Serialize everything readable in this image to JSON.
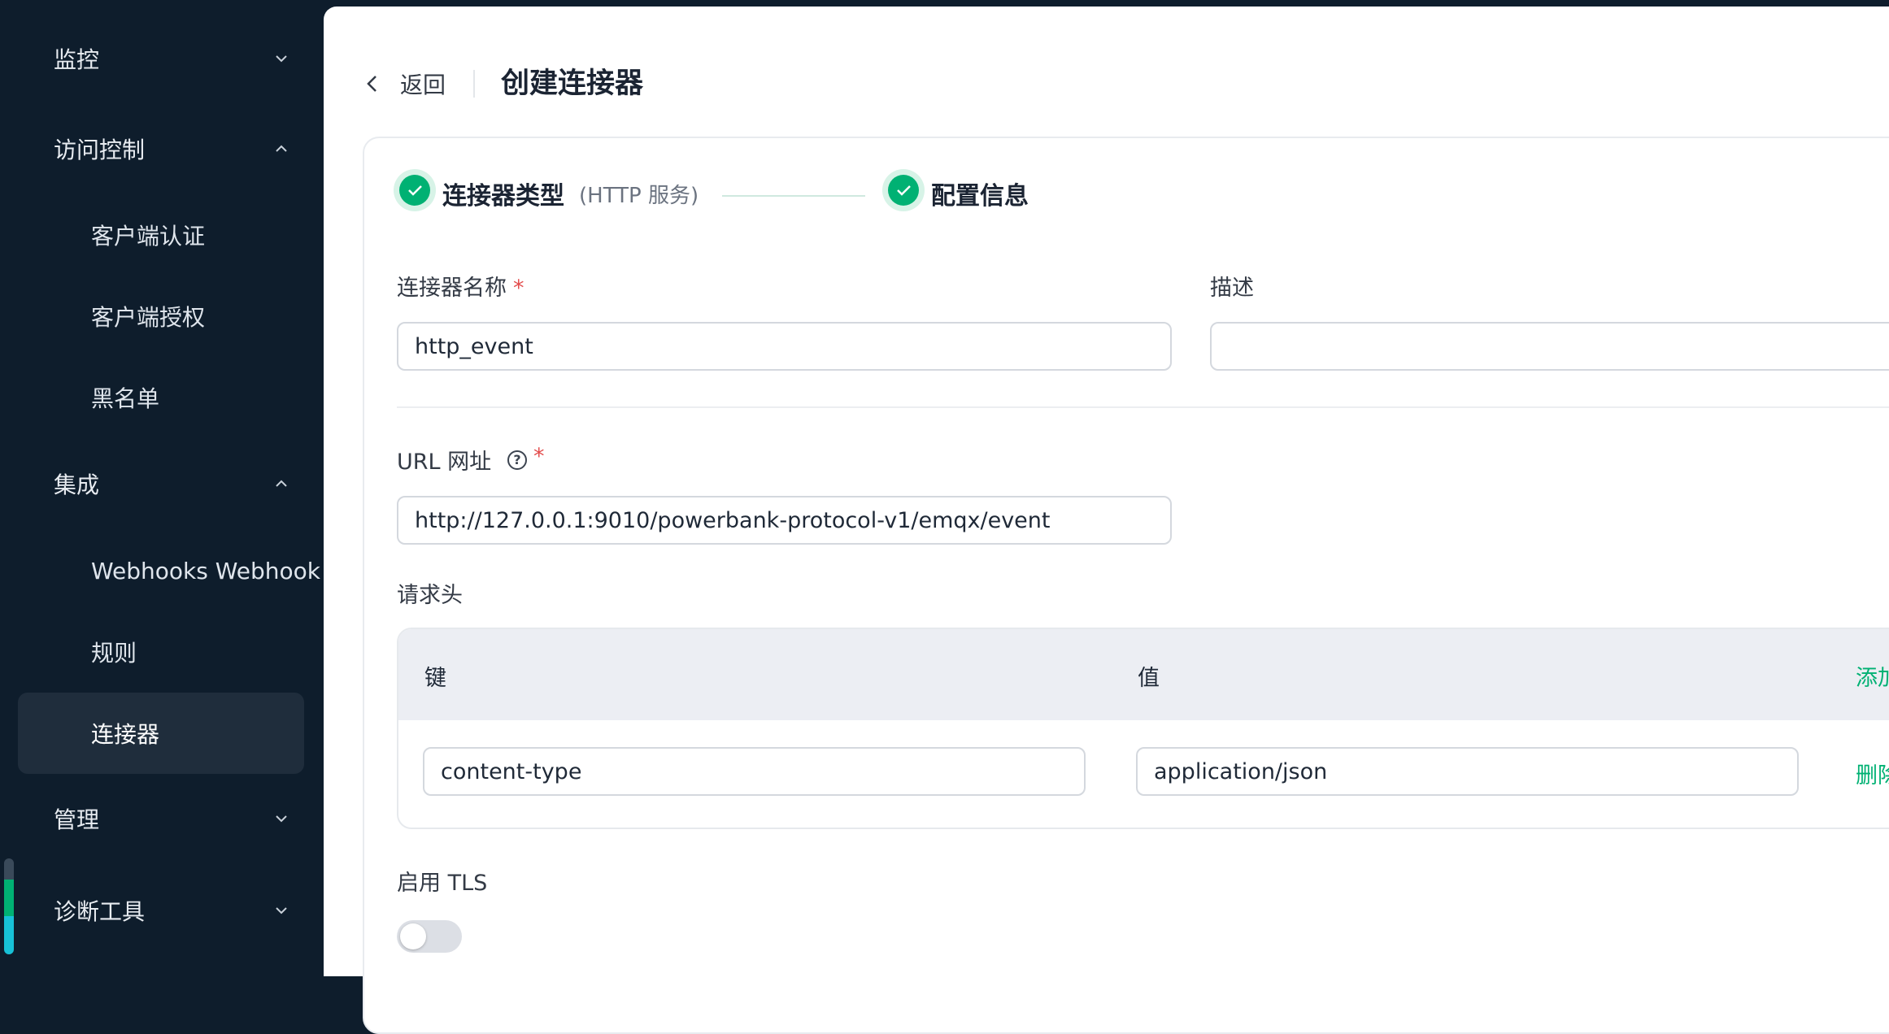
{
  "sidebar": {
    "groups": {
      "monitor": "监控",
      "access": "访问控制",
      "integration": "集成",
      "management": "管理",
      "diagnostics": "诊断工具"
    },
    "items": {
      "client_auth": "客户端认证",
      "client_authz": "客户端授权",
      "blacklist": "黑名单",
      "webhooks": "Webhooks  Webhook",
      "rules": "规则",
      "connectors": "连接器"
    }
  },
  "header": {
    "back_label": "返回",
    "title": "创建连接器"
  },
  "steps": [
    {
      "title": "连接器类型",
      "subtitle": "(HTTP 服务)"
    },
    {
      "title": "配置信息"
    }
  ],
  "form": {
    "name_label": "连接器名称",
    "required_mark": "*",
    "name_value": "http_event",
    "desc_label": "描述",
    "desc_value": "",
    "url_label": "URL  网址",
    "help_glyph": "?",
    "url_value": "http://127.0.0.1:9010/powerbank-protocol-v1/emqx/event",
    "headers_label": "请求头",
    "headers_table": {
      "key_header": "键",
      "value_header": "值",
      "add_label": "添加",
      "rows": [
        {
          "key": "content-type",
          "value": "application/json",
          "delete_label": "删除"
        }
      ]
    },
    "tls_label": "启用 TLS",
    "tls_enabled": false
  },
  "colors": {
    "sidebar_bg": "#0e1d2c",
    "accent": "#00b173",
    "required": "#e34d4d"
  }
}
